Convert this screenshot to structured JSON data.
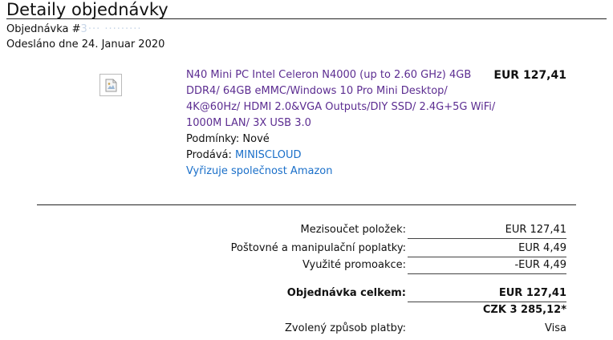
{
  "heading": "Detaily objednávky",
  "order": {
    "number_label": "Objednávka #",
    "number_redacted": "3··· ·········",
    "sent": "Odesláno dne 24. Januar 2020"
  },
  "item": {
    "image_icon": "broken-image-icon",
    "title": "N40 Mini PC Intel Celeron N4000 (up to 2.60 GHz) 4GB DDR4/ 64GB eMMC/Windows 10 Pro Mini Desktop/ 4K@60Hz/ HDMI 2.0&VGA Outputs/DIY SSD/ 2.4G+5G WiFi/ 1000M LAN/ 3X USB 3.0",
    "price": "EUR 127,41",
    "condition": "Podmínky: Nové",
    "seller_label": "Prodává: ",
    "seller": "MINISCLOUD",
    "fulfilled_by": "Vyřizuje společnost Amazon"
  },
  "summary": {
    "subtotal_label": "Mezisoučet položek:",
    "subtotal_value": "EUR 127,41",
    "shipping_label": "Poštovné a manipulační poplatky:",
    "shipping_value": "EUR 4,49",
    "promo_label": "Využité promoakce:",
    "promo_value": "-EUR 4,49",
    "total_label": "Objednávka celkem:",
    "total_value": "EUR 127,41",
    "total_czk": "CZK 3 285,12*",
    "payment_label": "Zvolený způsob platby:",
    "payment_value": "Visa"
  }
}
